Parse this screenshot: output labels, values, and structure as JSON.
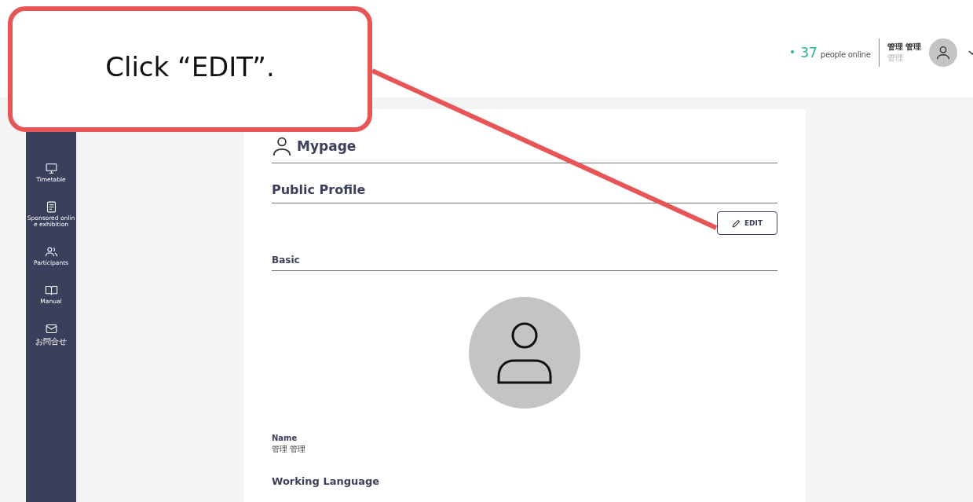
{
  "header": {
    "online_count": "37",
    "online_label": "people online",
    "user_name": "管理 管理",
    "user_role": "管理"
  },
  "sidebar": {
    "items": [
      {
        "label": "Timetable"
      },
      {
        "label": "Sponsored online exhibition"
      },
      {
        "label": "Participants"
      },
      {
        "label": "Manual"
      },
      {
        "label": "お問合せ"
      }
    ]
  },
  "page": {
    "title": "Mypage",
    "section": "Public Profile",
    "edit_button": "EDIT",
    "subsection": "Basic",
    "fields": [
      {
        "label": "Name",
        "value": "管理 管理"
      }
    ],
    "next_heading": "Working Language"
  },
  "callout": {
    "text": "Click “EDIT”."
  }
}
